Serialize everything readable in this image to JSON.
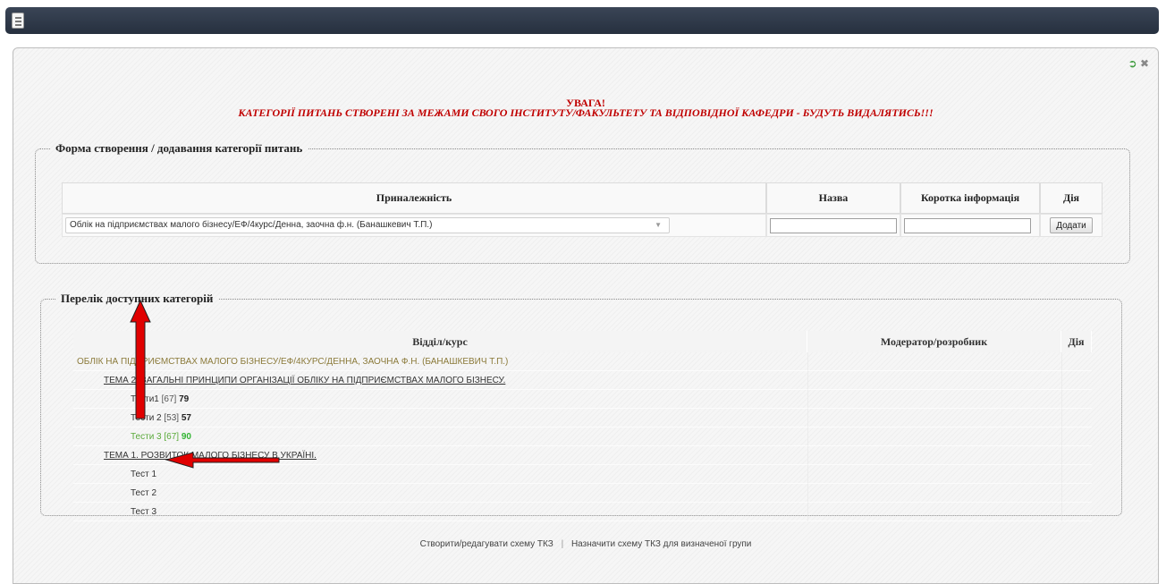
{
  "topbar": {
    "menu_icon": "menu-icon"
  },
  "window_icons": {
    "refresh": "refresh-icon",
    "close": "close-icon"
  },
  "warning": {
    "title": "УВАГА!",
    "text": "КАТЕГОРІЇ ПИТАНЬ СТВОРЕНІ ЗА МЕЖАМИ СВОГО ІНСТИТУТУ/ФАКУЛЬТЕТУ ТА ВІДПОВІДНОЇ КАФЕДРИ - БУДУТЬ ВИДАЛЯТИСЬ!!!",
    "color": "#c00000"
  },
  "create_form": {
    "legend": "Форма створення / додавання категорії питань",
    "headers": [
      "Приналежність",
      "Назва",
      "Коротка інформація",
      "Дія"
    ],
    "selected_affiliation": "Облік на підприємствах малого бізнесу/ЕФ/4курс/Денна, заочна ф.н. (Банашкевич Т.П.)",
    "name_value": "",
    "info_value": "",
    "add_button": "Додати"
  },
  "category_list": {
    "legend": "Перелік доступних категорій",
    "headers": [
      "Відділ/курс",
      "Модератор/розробник",
      "Дія"
    ],
    "department": "ОБЛІК НА ПІДПРИЄМСТВАХ МАЛОГО БІЗНЕСУ/ЕФ/4КУРС/ДЕННА, ЗАОЧНА Ф.Н. (БАНАШКЕВИЧ Т.П.)",
    "topic2": {
      "title": "ТЕМА 2. ЗАГАЛЬНІ ПРИНЦИПИ ОРГАНІЗАЦІЇ ОБЛІКУ НА ПІДПРИЄМСТВАХ МАЛОГО БІЗНЕСУ.",
      "tests": [
        {
          "name": "Тести1",
          "meta": "[67]",
          "score": "79"
        },
        {
          "name": "Тести 2",
          "meta": "[53]",
          "score": "57"
        },
        {
          "name": "Тести 3",
          "meta": "[67]",
          "score": "90"
        }
      ]
    },
    "topic1": {
      "title": "ТЕМА 1. РОЗВИТОК МАЛОГО БІЗНЕСУ В УКРАЇНІ.",
      "tests": [
        {
          "name": "Тест 1"
        },
        {
          "name": "Тест 2"
        },
        {
          "name": "Тест 3"
        }
      ]
    },
    "highlight_color": "#33b534"
  },
  "footer": {
    "link1": "Створити/редагувати схему ТКЗ",
    "separator": "|",
    "link2": "Назначити схему ТКЗ для визначеної групи"
  },
  "annotation_color": "#e00000"
}
